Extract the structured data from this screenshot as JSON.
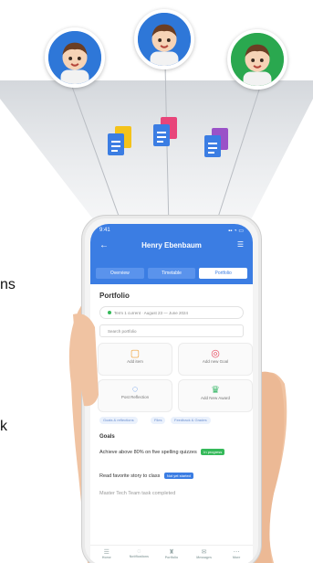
{
  "edge_text": {
    "line1": "ns",
    "line2": "k"
  },
  "avatars": [
    {
      "name": "child-1",
      "ring": "#2e77d8"
    },
    {
      "name": "child-2",
      "ring": "#2e77d8"
    },
    {
      "name": "child-3",
      "ring": "#2aa84f"
    }
  ],
  "docs": [
    {
      "back": "#f4c21a"
    },
    {
      "back": "#e8457a"
    },
    {
      "back": "#9a52c8"
    }
  ],
  "phone": {
    "status": {
      "time": "9:41",
      "signal": "▪▪ ◔ ▭"
    },
    "appbar": {
      "title": "Henry Ebenbaum",
      "back_icon": "←",
      "menu_icon": "☰"
    },
    "tabs": [
      "Overview",
      "Timetable",
      "Portfolio"
    ],
    "active_tab": 2,
    "portfolio_title": "Portfolio",
    "status_pill": "Term 1 current · August 23 — June 2024",
    "search_placeholder": "Search portfolio",
    "tiles": [
      {
        "label": "Add item",
        "icon": "▢",
        "color": "#f0a33a"
      },
      {
        "label": "Add new Goal",
        "icon": "◎",
        "color": "#e84a5f"
      },
      {
        "label": "Post Reflection",
        "icon": "◌",
        "color": "#3b7de3"
      },
      {
        "label": "Add New Award",
        "icon": "♛",
        "color": "#3bb86a"
      }
    ],
    "chips": [
      "Goals & reflections",
      "Files",
      "Feedback & Grades"
    ],
    "goals_title": "Goals",
    "goals": [
      {
        "text": "Achieve above 80% on five spelling quizzes",
        "badge": "In progress",
        "badge_color": "#35b95a"
      },
      {
        "text": "Read favorite story to class",
        "badge": "Not yet started",
        "badge_color": "#3b7de3"
      },
      {
        "text": "Master Tech Team task completed",
        "badge": "",
        "badge_color": ""
      }
    ],
    "bottom_nav": [
      "Home",
      "Notifications",
      "Portfolio",
      "Messages",
      "More"
    ]
  }
}
